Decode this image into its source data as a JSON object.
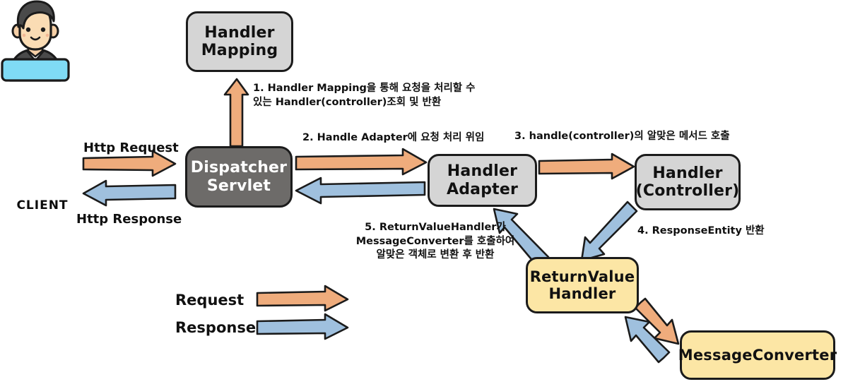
{
  "diagram": {
    "title": "Spring MVC Request Handling Flow",
    "colors": {
      "arrow_request": "#efac7c",
      "arrow_response": "#9fc0de",
      "node_gray": "#d5d5d5",
      "node_dark_gray": "#6d6b69",
      "node_yellow": "#fce6a5",
      "outline": "#1b1b1b",
      "badge_cyan": "#7fdbf5"
    }
  },
  "client": {
    "badge_label": "CLIENT",
    "icon": "user-avatar-icon"
  },
  "nodes": {
    "handler_mapping": {
      "line1": "Handler",
      "line2": "Mapping"
    },
    "dispatcher_servlet": {
      "line1": "Dispatcher",
      "line2": "Servlet"
    },
    "handler_adapter": {
      "line1": "Handler",
      "line2": "Adapter"
    },
    "handler_controller": {
      "line1": "Handler",
      "line2": "(Controller)"
    },
    "returnvalue_handler": {
      "line1": "ReturnValue",
      "line2": "Handler"
    },
    "message_converter": {
      "line1": "MessageConverter"
    }
  },
  "edge_labels": {
    "http_request": "Http Request",
    "http_response": "Http Response",
    "step1": "1. Handler Mapping을 통해 요청을 처리할 수\n   있는 Handler(controller)조회 및 반환",
    "step2": "2. Handle Adapter에 요청 처리 위임",
    "step3": "3. handle(controller)의 알맞은 메서드 호출",
    "step4": "4. ResponseEntity 반환",
    "step5": "5. ReturnValueHandler가\nMessageConverter를 호출하여\n알맞은 객체로 변환 후 반환"
  },
  "legend": {
    "request_label": "Request",
    "response_label": "Response"
  }
}
